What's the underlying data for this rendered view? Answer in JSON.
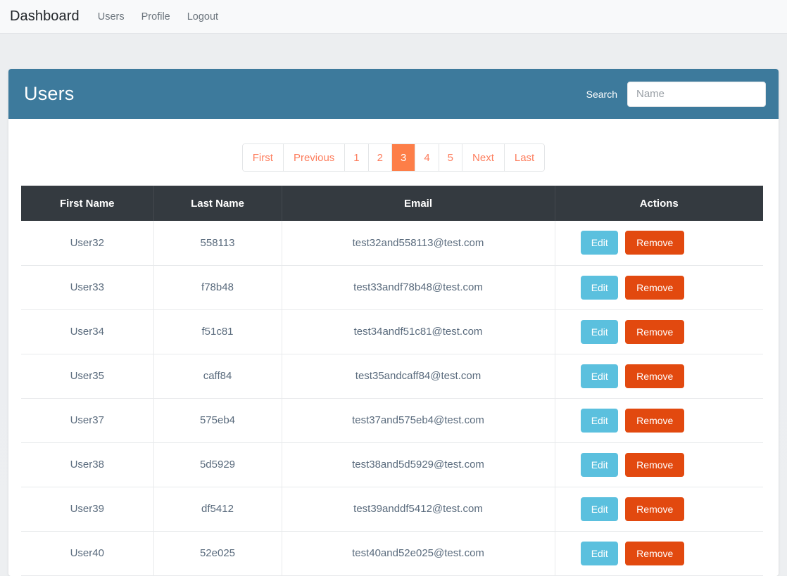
{
  "navbar": {
    "brand": "Dashboard",
    "links": [
      {
        "label": "Users"
      },
      {
        "label": "Profile"
      },
      {
        "label": "Logout"
      }
    ]
  },
  "panel": {
    "title": "Users",
    "search": {
      "label": "Search",
      "placeholder": "Name",
      "value": ""
    }
  },
  "pagination": {
    "items": [
      {
        "label": "First",
        "active": false
      },
      {
        "label": "Previous",
        "active": false
      },
      {
        "label": "1",
        "active": false
      },
      {
        "label": "2",
        "active": false
      },
      {
        "label": "3",
        "active": true
      },
      {
        "label": "4",
        "active": false
      },
      {
        "label": "5",
        "active": false
      },
      {
        "label": "Next",
        "active": false
      },
      {
        "label": "Last",
        "active": false
      }
    ],
    "current_page": "3"
  },
  "table": {
    "columns": [
      "First Name",
      "Last Name",
      "Email",
      "Actions"
    ],
    "actions": {
      "edit_label": "Edit",
      "remove_label": "Remove"
    },
    "rows": [
      {
        "first_name": "User32",
        "last_name": "558113",
        "email": "test32and558113@test.com"
      },
      {
        "first_name": "User33",
        "last_name": "f78b48",
        "email": "test33andf78b48@test.com"
      },
      {
        "first_name": "User34",
        "last_name": "f51c81",
        "email": "test34andf51c81@test.com"
      },
      {
        "first_name": "User35",
        "last_name": "caff84",
        "email": "test35andcaff84@test.com"
      },
      {
        "first_name": "User37",
        "last_name": "575eb4",
        "email": "test37and575eb4@test.com"
      },
      {
        "first_name": "User38",
        "last_name": "5d5929",
        "email": "test38and5d5929@test.com"
      },
      {
        "first_name": "User39",
        "last_name": "df5412",
        "email": "test39anddf5412@test.com"
      },
      {
        "first_name": "User40",
        "last_name": "52e025",
        "email": "test40and52e025@test.com"
      }
    ]
  },
  "colors": {
    "panel_header": "#3d7a9c",
    "table_header": "#343a40",
    "accent_orange": "#fd7e48",
    "edit_button": "#5bc0de",
    "remove_button": "#e2490f",
    "page_background": "#eceef1"
  }
}
